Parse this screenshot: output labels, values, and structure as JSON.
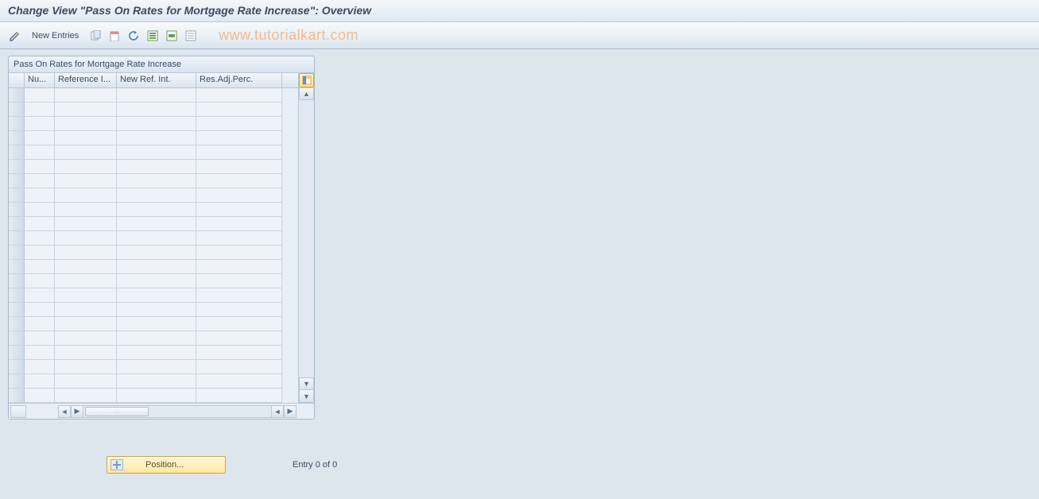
{
  "header": {
    "title": "Change View \"Pass On Rates for Mortgage Rate Increase\": Overview"
  },
  "toolbar": {
    "new_entries_label": "New Entries",
    "icons": {
      "toggle": "toggle-change-display",
      "copy": "copy-as",
      "delete": "delete",
      "undo": "undo-change",
      "select_all": "select-all",
      "select_block": "select-block",
      "deselect_all": "deselect-all"
    }
  },
  "watermark": "www.tutorialkart.com",
  "table": {
    "title": "Pass On Rates for Mortgage Rate Increase",
    "columns": [
      "Nu...",
      "Reference I...",
      "New Ref. Int.",
      "Res.Adj.Perc."
    ],
    "row_count": 22
  },
  "footer": {
    "position_label": "Position...",
    "entry_text": "Entry 0 of 0"
  }
}
